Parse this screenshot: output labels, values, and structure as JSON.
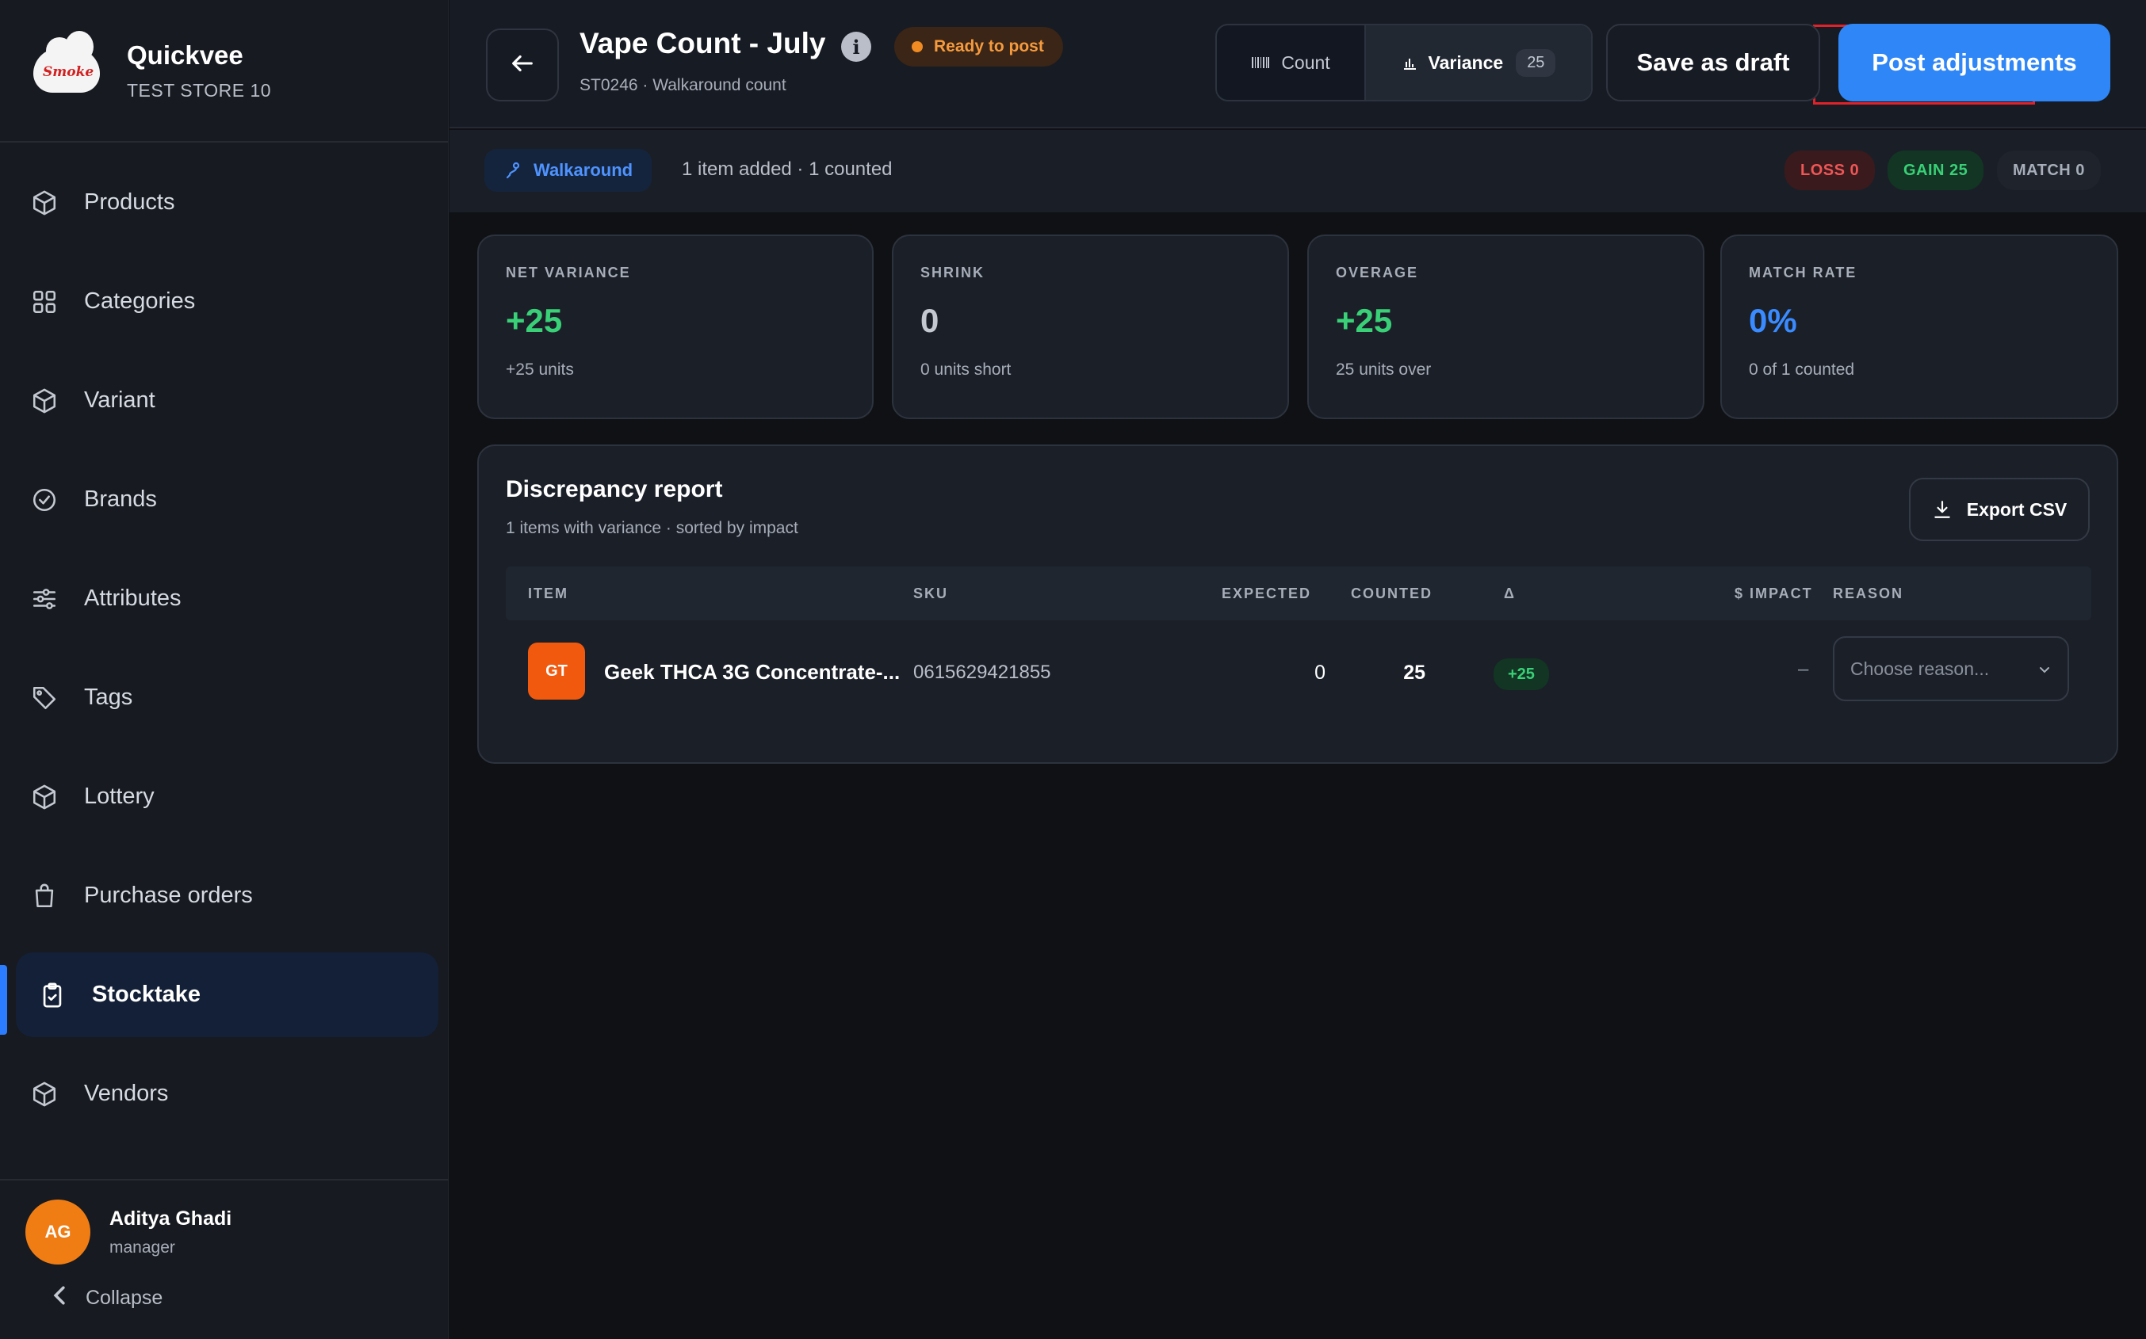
{
  "brand": {
    "name": "Quickvee",
    "store": "TEST STORE 10",
    "logo_text": "Smoke"
  },
  "sidebar": {
    "items": [
      {
        "label": "Products",
        "icon": "cube-icon"
      },
      {
        "label": "Categories",
        "icon": "grid-icon"
      },
      {
        "label": "Variant",
        "icon": "cube-icon"
      },
      {
        "label": "Brands",
        "icon": "badge-check-icon"
      },
      {
        "label": "Attributes",
        "icon": "sliders-icon"
      },
      {
        "label": "Tags",
        "icon": "tag-icon"
      },
      {
        "label": "Lottery",
        "icon": "cube-icon"
      },
      {
        "label": "Purchase orders",
        "icon": "shopping-bag-icon"
      },
      {
        "label": "Stocktake",
        "icon": "clipboard-check-icon",
        "active": true
      },
      {
        "label": "Vendors",
        "icon": "cube-icon"
      }
    ]
  },
  "user": {
    "initials": "AG",
    "name": "Aditya Ghadi",
    "role": "manager",
    "collapse_label": "Collapse"
  },
  "header": {
    "title": "Vape Count - July",
    "status": "Ready to post",
    "subtitle": "ST0246 · Walkaround count",
    "tabs": {
      "count_label": "Count",
      "variance_label": "Variance",
      "variance_badge": "25",
      "selected": "Variance"
    },
    "save_draft_label": "Save as draft",
    "post_label": "Post adjustments"
  },
  "modebar": {
    "mode_label": "Walkaround",
    "info": "1 item added · 1 counted",
    "loss_label": "LOSS 0",
    "gain_label": "GAIN 25",
    "match_label": "MATCH 0"
  },
  "stats": [
    {
      "label": "NET VARIANCE",
      "value": "+25",
      "sub": "+25 units"
    },
    {
      "label": "SHRINK",
      "value": "0",
      "sub": "0 units short"
    },
    {
      "label": "OVERAGE",
      "value": "+25",
      "sub": "25 units over"
    },
    {
      "label": "MATCH RATE",
      "value": "0%",
      "sub": "0 of 1 counted"
    }
  ],
  "report": {
    "title": "Discrepancy report",
    "subtitle": "1 items with variance · sorted by impact",
    "export_label": "Export CSV",
    "columns": [
      "ITEM",
      "SKU",
      "EXPECTED",
      "COUNTED",
      "Δ",
      "$ IMPACT",
      "REASON"
    ],
    "rows": [
      {
        "initials": "GT",
        "item": "Geek THCA 3G Concentrate-...",
        "sku": "0615629421855",
        "expected": "0",
        "counted": "25",
        "delta": "+25",
        "impact": "–",
        "reason_placeholder": "Choose reason..."
      }
    ]
  },
  "colors": {
    "accent": "#2f86f6",
    "gain": "#39d077",
    "loss": "#ef5656",
    "status": "#f59a3d",
    "highlight": "#e0222a"
  }
}
